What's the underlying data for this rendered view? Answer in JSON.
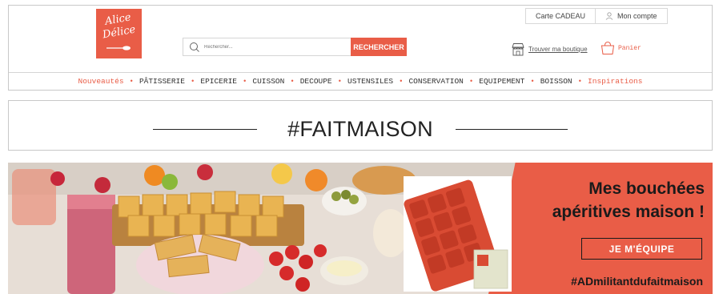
{
  "brand": {
    "logo_line1": "Alice",
    "logo_line2": "Délice"
  },
  "top_links": {
    "gift_card": "Carte CADEAU",
    "account": "Mon compte"
  },
  "search": {
    "placeholder": "Rechercher...",
    "button": "RECHERCHER"
  },
  "store_link": "Trouver ma boutique",
  "cart_label": "Panier",
  "nav": {
    "items": [
      {
        "label": "Nouveautés",
        "accent": true
      },
      {
        "label": "PÂTISSERIE",
        "accent": false
      },
      {
        "label": "EPICERIE",
        "accent": false
      },
      {
        "label": "CUISSON",
        "accent": false
      },
      {
        "label": "DECOUPE",
        "accent": false
      },
      {
        "label": "USTENSILES",
        "accent": false
      },
      {
        "label": "CONSERVATION",
        "accent": false
      },
      {
        "label": "EQUIPEMENT",
        "accent": false
      },
      {
        "label": "BOISSON",
        "accent": false
      },
      {
        "label": "Inspirations",
        "accent": true
      }
    ]
  },
  "banner": {
    "title": "#FAITMAISON"
  },
  "hero": {
    "title_line1": "Mes bouchées",
    "title_line2": "apéritives maison !",
    "cta": "JE M'ÉQUIPE",
    "hashtag": "#ADmilitantdufaitmaison"
  },
  "colors": {
    "brand": "#e95d47",
    "text": "#333333",
    "dark": "#1a1a1a"
  },
  "icons": [
    "search-icon",
    "user-icon",
    "store-icon",
    "shopping-bag-icon",
    "spoon-icon"
  ]
}
